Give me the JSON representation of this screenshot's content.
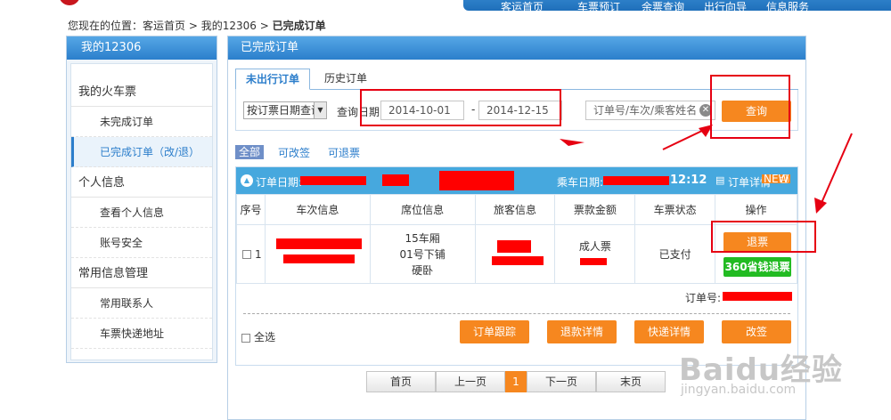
{
  "top_nav": {
    "items": [
      "客运首页",
      "车票预订",
      "余票查询",
      "出行向导",
      "信息服务"
    ]
  },
  "breadcrumb": {
    "prefix": "您现在的位置：",
    "home": "客运首页",
    "sep1": " > ",
    "mine": "我的12306",
    "sep2": " > ",
    "current": "已完成订单"
  },
  "sidebar": {
    "title": "我的12306",
    "sections": [
      {
        "label": "我的火车票",
        "items": [
          {
            "label": "未完成订单",
            "active": false
          },
          {
            "label": "已完成订单（改/退）",
            "active": true
          }
        ]
      },
      {
        "label": "个人信息",
        "items": [
          {
            "label": "查看个人信息",
            "active": false
          },
          {
            "label": "账号安全",
            "active": false
          }
        ]
      },
      {
        "label": "常用信息管理",
        "items": [
          {
            "label": "常用联系人",
            "active": false
          },
          {
            "label": "车票快递地址",
            "active": false
          }
        ]
      }
    ]
  },
  "main": {
    "title": "已完成订单",
    "tabs": [
      {
        "label": "未出行订单",
        "active": true
      },
      {
        "label": "历史订单",
        "active": false
      }
    ],
    "query": {
      "select_value": "按订票日期查询",
      "date_label": "查询日期",
      "date_from": "2014-10-01",
      "date_sep": "-",
      "date_to": "2014-12-15",
      "search_placeholder": "订单号/车次/乘客姓名",
      "query_button": "查询"
    },
    "filters": [
      "全部",
      "可改签",
      "可退票"
    ],
    "order": {
      "order_date_label": "订单日期:",
      "depart_date_label": "乘车日期:",
      "depart_time": "12:12",
      "detail_label": "订单详情",
      "new_badge": "NEW",
      "columns": [
        "序号",
        "车次信息",
        "席位信息",
        "旅客信息",
        "票款金额",
        "车票状态",
        "操作"
      ],
      "row": {
        "index": "1",
        "seat_car": "15车厢",
        "seat_no": "01号下铺",
        "seat_type": "硬卧",
        "ticket_type": "成人票",
        "status": "已支付",
        "refund_button": "退票",
        "refund360_button": "360省钱退票"
      },
      "order_no_label": "订单号:",
      "select_all": "全选",
      "actions": [
        "订单跟踪",
        "退款详情",
        "快递详情",
        "改签"
      ]
    },
    "pager": {
      "first": "首页",
      "prev": "上一页",
      "current": "1",
      "next": "下一页",
      "last": "末页"
    }
  },
  "watermark": {
    "brand": "Baidu经验",
    "url": "jingyan.baidu.com"
  },
  "colors": {
    "accent_blue": "#2c7ecb",
    "orange": "#f6871f",
    "green": "#22bb22",
    "highlight_red": "#e60012"
  }
}
